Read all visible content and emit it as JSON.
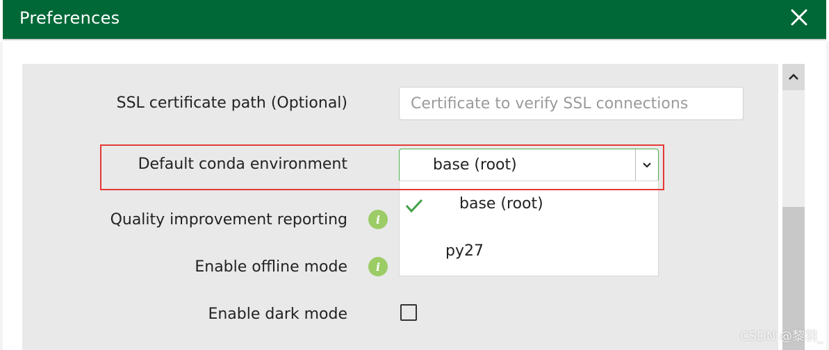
{
  "dialog": {
    "title": "Preferences",
    "close_icon": "close-icon"
  },
  "settings": {
    "ssl": {
      "label": "SSL certificate path (Optional)",
      "placeholder": "Certificate to verify SSL connections",
      "value": ""
    },
    "conda_env": {
      "label": "Default conda environment",
      "selected": "base (root)",
      "options": [
        {
          "label": "base (root)",
          "selected": true
        },
        {
          "label": "py27",
          "selected": false
        }
      ]
    },
    "quality": {
      "label": "Quality improvement reporting",
      "icon": "info-icon"
    },
    "offline": {
      "label": "Enable offline mode",
      "icon": "info-icon"
    },
    "dark_mode": {
      "label": "Enable dark mode",
      "checked": false
    }
  },
  "colors": {
    "titlebar": "#006837",
    "highlight_box": "#e53935",
    "select_border": "#4cae4c",
    "info_icon": "#9ccc65"
  },
  "watermark": "CSDN @黎羽_"
}
